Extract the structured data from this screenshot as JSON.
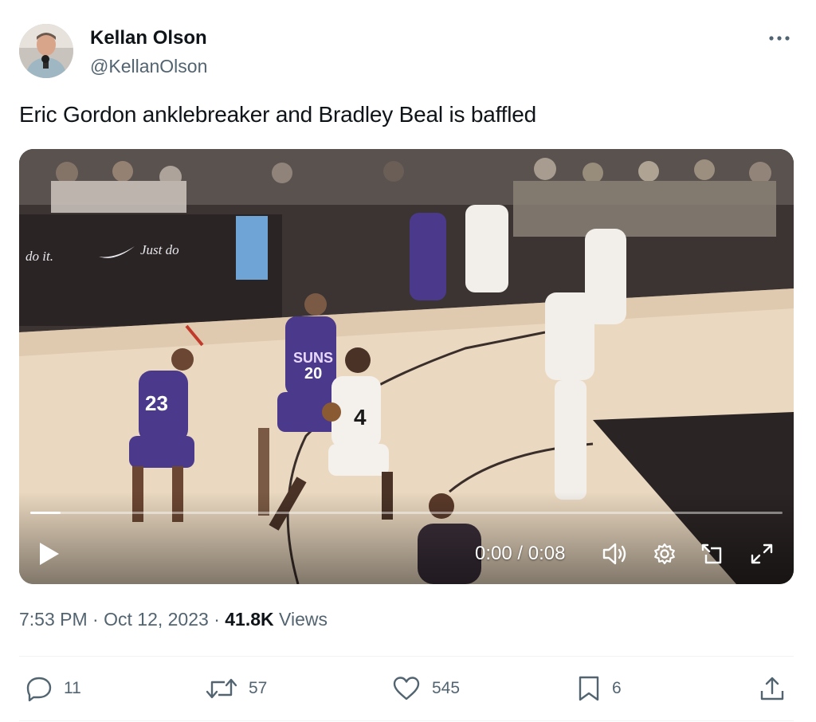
{
  "author": {
    "display_name": "Kellan Olson",
    "handle": "@KellanOlson"
  },
  "tweet": {
    "text": "Eric Gordon anklebreaker and Bradley Beal is baffled"
  },
  "video": {
    "time_display": "0:00 / 0:08",
    "progress_fraction": 0.04,
    "court_ad_left": "do it.",
    "court_ad_right": "Just do",
    "jersey_numbers": [
      "23",
      "20",
      "4"
    ],
    "jersey_team_text": "SUNS"
  },
  "meta": {
    "time": "7:53 PM",
    "separator": " · ",
    "date": "Oct 12, 2023",
    "views_count": "41.8K",
    "views_label": " Views"
  },
  "actions": {
    "replies": "11",
    "reposts": "57",
    "likes": "545",
    "bookmarks": "6"
  },
  "icons": {
    "more": "more-dots-icon",
    "play": "play-icon",
    "volume": "volume-icon",
    "settings": "gear-icon",
    "pip": "picture-in-picture-icon",
    "fullscreen": "fullscreen-icon",
    "reply": "reply-bubble-icon",
    "repost": "repost-arrows-icon",
    "like": "heart-icon",
    "bookmark": "bookmark-icon",
    "share": "share-upload-icon"
  },
  "colors": {
    "text_primary": "#0f1419",
    "text_secondary": "#536471",
    "suns_purple": "#4b3a8c"
  }
}
